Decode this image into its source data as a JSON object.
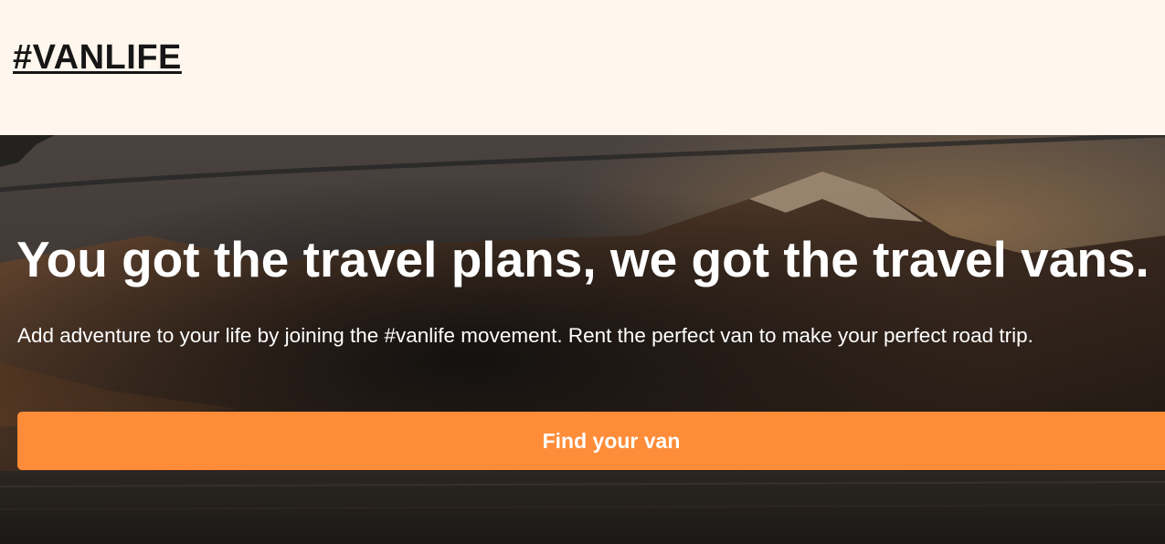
{
  "header": {
    "logo_text": "#VANLIFE"
  },
  "hero": {
    "title": "You got the travel plans, we got the travel vans.",
    "subtitle": "Add adventure to your life by joining the #vanlife movement. Rent the perfect van to make your perfect road trip.",
    "background_image": "mountain-lake-landscape",
    "cta_label": "Find your van"
  },
  "colors": {
    "header_background": "#FFF7ED",
    "logo_text": "#161616",
    "hero_text": "#FFFFFF",
    "cta_background": "#FF8C38",
    "cta_text": "#FFFFFF"
  }
}
